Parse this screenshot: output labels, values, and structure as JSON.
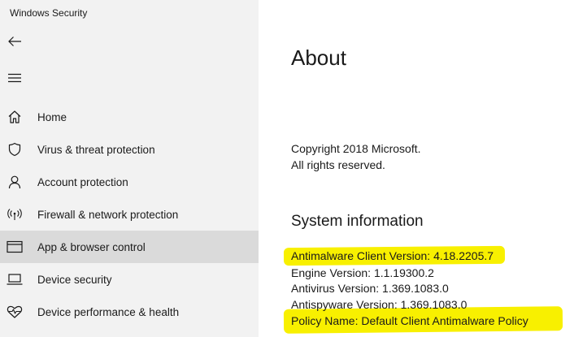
{
  "window": {
    "title": "Windows Security"
  },
  "toolbar": {
    "back_icon": "back-arrow-icon",
    "menu_icon": "hamburger-menu-icon"
  },
  "sidebar": {
    "items": [
      {
        "label": "Home",
        "icon": "home-icon"
      },
      {
        "label": "Virus & threat protection",
        "icon": "shield-icon"
      },
      {
        "label": "Account protection",
        "icon": "person-icon"
      },
      {
        "label": "Firewall & network protection",
        "icon": "wifi-signal-icon"
      },
      {
        "label": "App & browser control",
        "icon": "app-browser-icon",
        "selected": true
      },
      {
        "label": "Device security",
        "icon": "laptop-icon"
      },
      {
        "label": "Device performance & health",
        "icon": "heart-pulse-icon"
      }
    ]
  },
  "main": {
    "title": "About",
    "copyright_line1": "Copyright 2018 Microsoft.",
    "copyright_line2": "All rights reserved.",
    "system_info_title": "System information",
    "info": {
      "antimalware_client_version": "Antimalware Client Version: 4.18.2205.7",
      "engine_version": "Engine Version: 1.1.19300.2",
      "antivirus_version": "Antivirus Version: 1.369.1083.0",
      "antispyware_version": "Antispyware Version: 1.369.1083.0",
      "policy_name": "Policy Name: Default Client Antimalware Policy"
    }
  },
  "colors": {
    "sidebar_bg": "#f2f2f2",
    "selected_bg": "#dadada",
    "highlight": "#f8f000"
  }
}
